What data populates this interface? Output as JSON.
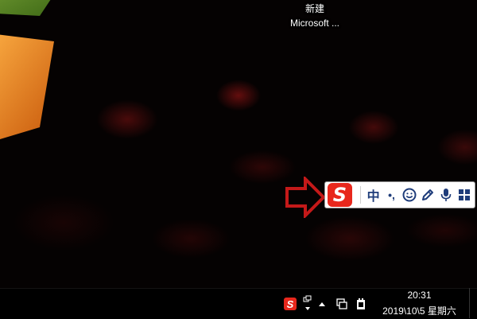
{
  "desktop": {
    "shortcut": {
      "line1": "新建",
      "line2": "Microsoft ..."
    },
    "annotation_arrow_color": "#c41919"
  },
  "ime_toolbar": {
    "logo_letter": "S",
    "mode_label": "中",
    "punct_label": "•,",
    "brand_color": "#e8271c",
    "icon_color": "#1e3c7a",
    "icons": [
      "sogou-logo-icon",
      "punctuation-icon",
      "emoji-icon",
      "skin-pen-icon",
      "microphone-icon",
      "toolbox-grid-icon"
    ]
  },
  "taskbar": {
    "tray_ime_letter": "S",
    "clock_time": "20:31",
    "clock_date": "2019\\10\\5 星期六",
    "tray_icons": [
      "sogou-tray-icon",
      "overflow-chevron-icon",
      "network-icon",
      "device-icon"
    ]
  }
}
